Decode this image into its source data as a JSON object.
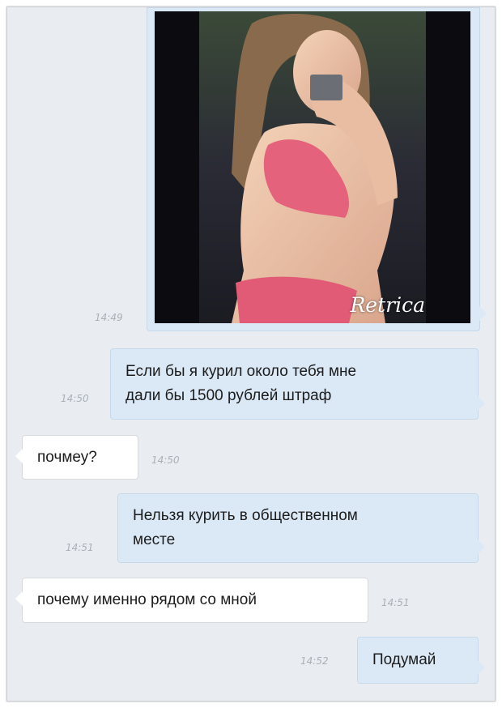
{
  "messages": [
    {
      "type": "photo",
      "direction": "outgoing",
      "time": "14:49",
      "watermark": "Retrica"
    },
    {
      "type": "text",
      "direction": "outgoing",
      "lines": [
        "Если бы я курил около тебя мне",
        "дали бы 1500 рублей штраф"
      ],
      "time": "14:50"
    },
    {
      "type": "text",
      "direction": "incoming",
      "lines": [
        "почмеу?"
      ],
      "time": "14:50"
    },
    {
      "type": "text",
      "direction": "outgoing",
      "lines": [
        "Нельзя курить в общественном",
        "месте"
      ],
      "time": "14:51"
    },
    {
      "type": "text",
      "direction": "incoming",
      "lines": [
        "почему именно рядом со мной"
      ],
      "time": "14:51"
    },
    {
      "type": "text",
      "direction": "outgoing",
      "lines": [
        "Подумай"
      ],
      "time": "14:52"
    }
  ],
  "colors": {
    "background": "#e9edf1",
    "outgoing_bubble": "#dbe9f6",
    "incoming_bubble": "#ffffff",
    "timestamp": "#a9b0b8"
  }
}
